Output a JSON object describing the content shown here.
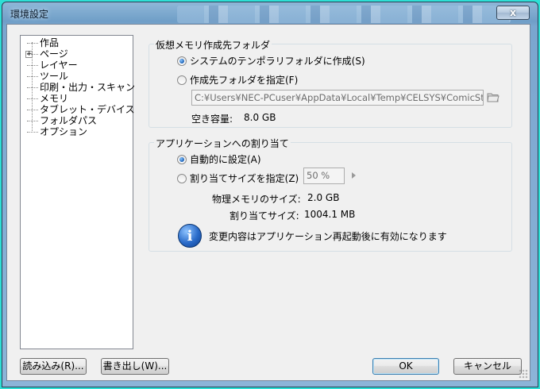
{
  "window": {
    "title": "環境設定",
    "close_label": "x"
  },
  "tree": {
    "items": [
      {
        "label": "作品",
        "expandable": false
      },
      {
        "label": "ページ",
        "expandable": true
      },
      {
        "label": "レイヤー",
        "expandable": false
      },
      {
        "label": "ツール",
        "expandable": false
      },
      {
        "label": "印刷・出力・スキャン",
        "expandable": false
      },
      {
        "label": "メモリ",
        "expandable": false
      },
      {
        "label": "タブレット・デバイス",
        "expandable": false
      },
      {
        "label": "フォルダパス",
        "expandable": false
      },
      {
        "label": "オプション",
        "expandable": false
      }
    ]
  },
  "virtual_memory": {
    "group_label": "仮想メモリ作成先フォルダ",
    "option_system_temp": "システムのテンポラリフォルダに作成(S)",
    "option_custom": "作成先フォルダを指定(F)",
    "selected": "system_temp",
    "path_value": "C:¥Users¥NEC-PCuser¥AppData¥Local¥Temp¥CELSYS¥ComicStudio¥I",
    "free_space_label": "空き容量:",
    "free_space_value": "8.0 GB"
  },
  "app_allocation": {
    "group_label": "アプリケーションへの割り当て",
    "option_auto": "自動的に設定(A)",
    "option_manual": "割り当てサイズを指定(Z)",
    "selected": "auto",
    "percent_value": "50 %",
    "physical_label": "物理メモリのサイズ:",
    "physical_value": "2.0 GB",
    "alloc_label": "割り当てサイズ:",
    "alloc_value": "1004.1 MB",
    "info_icon_glyph": "i",
    "info_text": "変更内容はアプリケーション再起動後に有効になります"
  },
  "buttons": {
    "load": "読み込み(R)...",
    "export": "書き出し(W)...",
    "ok": "OK",
    "cancel": "キャンセル"
  }
}
